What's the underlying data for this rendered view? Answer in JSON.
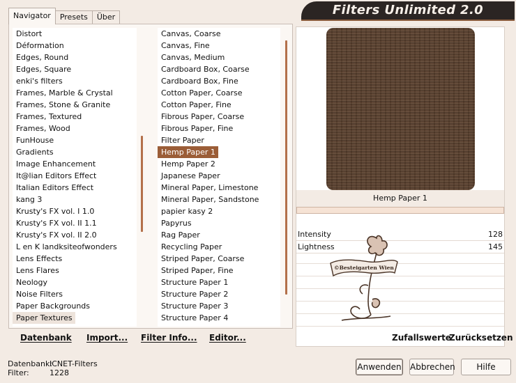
{
  "tabs": [
    "Navigator",
    "Presets",
    "Über"
  ],
  "title": "Filters Unlimited 2.0",
  "categories": [
    "Distort",
    "Déformation",
    "Edges, Round",
    "Edges, Square",
    "enki's filters",
    "Frames, Marble & Crystal",
    "Frames, Stone & Granite",
    "Frames, Textured",
    "Frames, Wood",
    "FunHouse",
    "Gradients",
    "Image Enhancement",
    "It@lian Editors Effect",
    "Italian Editors Effect",
    "kang 3",
    "Krusty's FX vol. I 1.0",
    "Krusty's FX vol. II 1.1",
    "Krusty's FX vol. II 2.0",
    "L en K landksiteofwonders",
    "Lens Effects",
    "Lens Flares",
    "Neology",
    "Noise Filters",
    "Paper Backgrounds",
    "Paper Textures"
  ],
  "selected_category": "Paper Textures",
  "filters": [
    "Canvas, Coarse",
    "Canvas, Fine",
    "Canvas, Medium",
    "Cardboard Box, Coarse",
    "Cardboard Box, Fine",
    "Cotton Paper, Coarse",
    "Cotton Paper, Fine",
    "Fibrous Paper, Coarse",
    "Fibrous Paper, Fine",
    "Filter Paper",
    "Hemp Paper 1",
    "Hemp Paper 2",
    "Japanese Paper",
    "Mineral Paper, Limestone",
    "Mineral Paper, Sandstone",
    "papier kasy 2",
    "Papyrus",
    "Rag Paper",
    "Recycling Paper",
    "Striped Paper, Coarse",
    "Striped Paper, Fine",
    "Structure Paper 1",
    "Structure Paper 2",
    "Structure Paper 3",
    "Structure Paper 4"
  ],
  "selected_filter": "Hemp Paper 1",
  "preview_filter_name": "Hemp Paper 1",
  "params": [
    {
      "label": "Intensity",
      "value": "128"
    },
    {
      "label": "Lightness",
      "value": "145"
    }
  ],
  "left_buttons": {
    "database": "Datenbank",
    "import": "Import...",
    "filter_info": "Filter Info...",
    "editor": "Editor..."
  },
  "right_buttons": {
    "random": "Zufallswerte",
    "reset": "Zurücksetzen"
  },
  "status": {
    "db_label": "Datenbank:",
    "db_value": "ICNET-Filters",
    "filter_label": "Filter:",
    "filter_value": "1228"
  },
  "dialog_buttons": {
    "apply": "Anwenden",
    "cancel": "Abbrechen",
    "help": "Hilfe"
  },
  "watermark": "©Besteigarten Wien",
  "colors": {
    "accent": "#9b5d37",
    "banner": "#2b2523",
    "background": "#f3ebe4",
    "preview_texture": "#583f2d"
  }
}
